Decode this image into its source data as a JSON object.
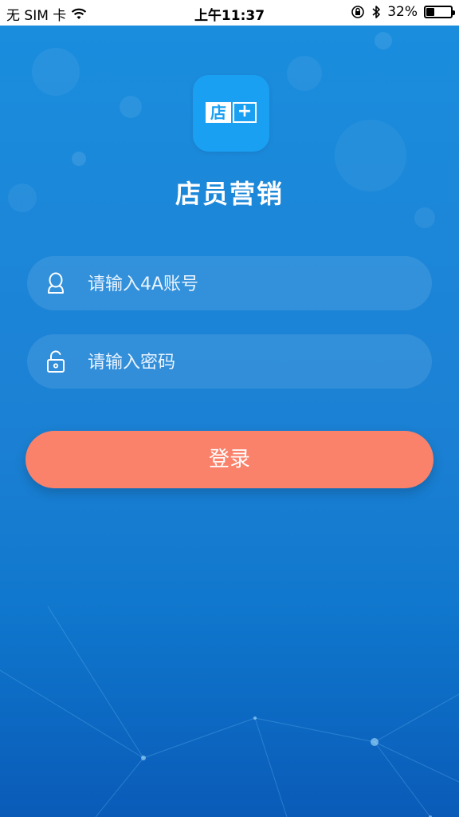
{
  "status_bar": {
    "carrier": "无 SIM 卡",
    "time": "上午11:37",
    "battery_percent": "32%",
    "battery_level": 0.32
  },
  "app": {
    "logo_char": "店",
    "logo_plus": "+",
    "title": "店员营销"
  },
  "login_form": {
    "account_placeholder": "请输入4A账号",
    "password_placeholder": "请输入密码",
    "submit_label": "登录"
  },
  "colors": {
    "background_top": "#1a8ede",
    "logo_bg": "#1aa0f2",
    "button": "#fa816a"
  }
}
